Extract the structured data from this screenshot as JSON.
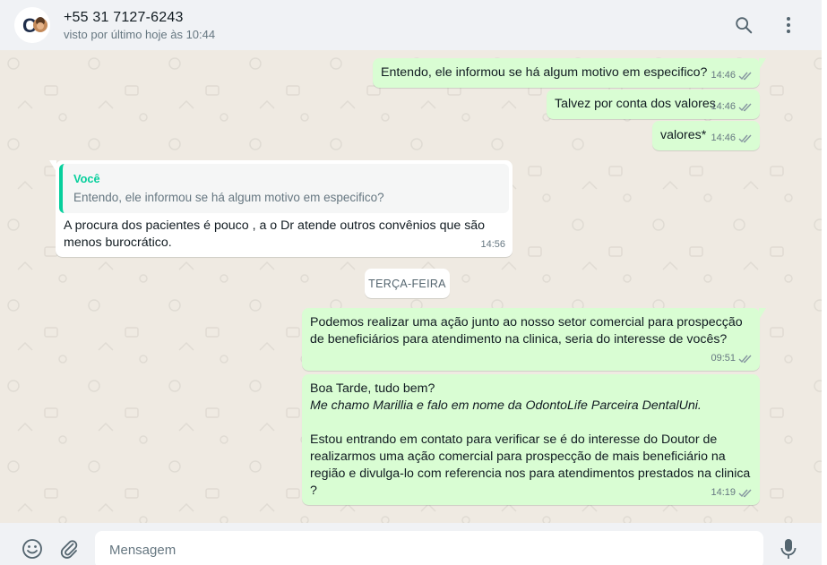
{
  "header": {
    "contact_name": "+55 31 7127-6243",
    "status": "visto por último hoje às 10:44",
    "avatar_text": "C"
  },
  "messages": [
    {
      "direction": "out",
      "text": "Entendo, ele informou se há algum motivo em especifico?",
      "time": "14:46"
    },
    {
      "direction": "out",
      "text": "Talvez por conta dos valores",
      "time": "14:46"
    },
    {
      "direction": "out",
      "text": "valores*",
      "time": "14:46"
    },
    {
      "direction": "in",
      "quote_author": "Você",
      "quote_text": "Entendo, ele informou se há algum motivo em especifico?",
      "line1": "A procura dos pacientes é pouco  , a o Dr atende outros convênios que são",
      "line2": "menos burocrático.",
      "time": "14:56"
    },
    {
      "direction": "out",
      "line1": "Podemos realizar uma ação junto ao nosso setor comercial para prospecção",
      "line2": "de beneficiários para atendimento na clinica, seria do interesse de vocês?",
      "time": "09:51"
    },
    {
      "direction": "out",
      "line1": "Boa Tarde, tudo bem?",
      "line2_italic": "Me chamo Marillia e falo em nome da OdontoLife Parceira DentalUni.",
      "line3": "Estou entrando em contato para verificar se é do interesse do Doutor de",
      "line4": "realizarmos uma ação comercial para prospecção de mais beneficiário na",
      "line5": "região e divulga-lo com referencia nos para atendimentos prestados na clinica",
      "line6": "?",
      "time": "14:19"
    }
  ],
  "day_separator": "TERÇA-FEIRA",
  "composer": {
    "placeholder": "Mensagem"
  },
  "icons": {
    "search": "search-icon",
    "menu": "menu-icon",
    "emoji": "emoji-icon",
    "attach": "attach-icon",
    "mic": "mic-icon",
    "read": "double-check-icon"
  },
  "colors": {
    "outgoing_bubble": "#d9fdd3",
    "incoming_bubble": "#ffffff",
    "chat_background": "#efeae2",
    "accent": "#06cf9c",
    "read_ticks": "#8696a0"
  }
}
